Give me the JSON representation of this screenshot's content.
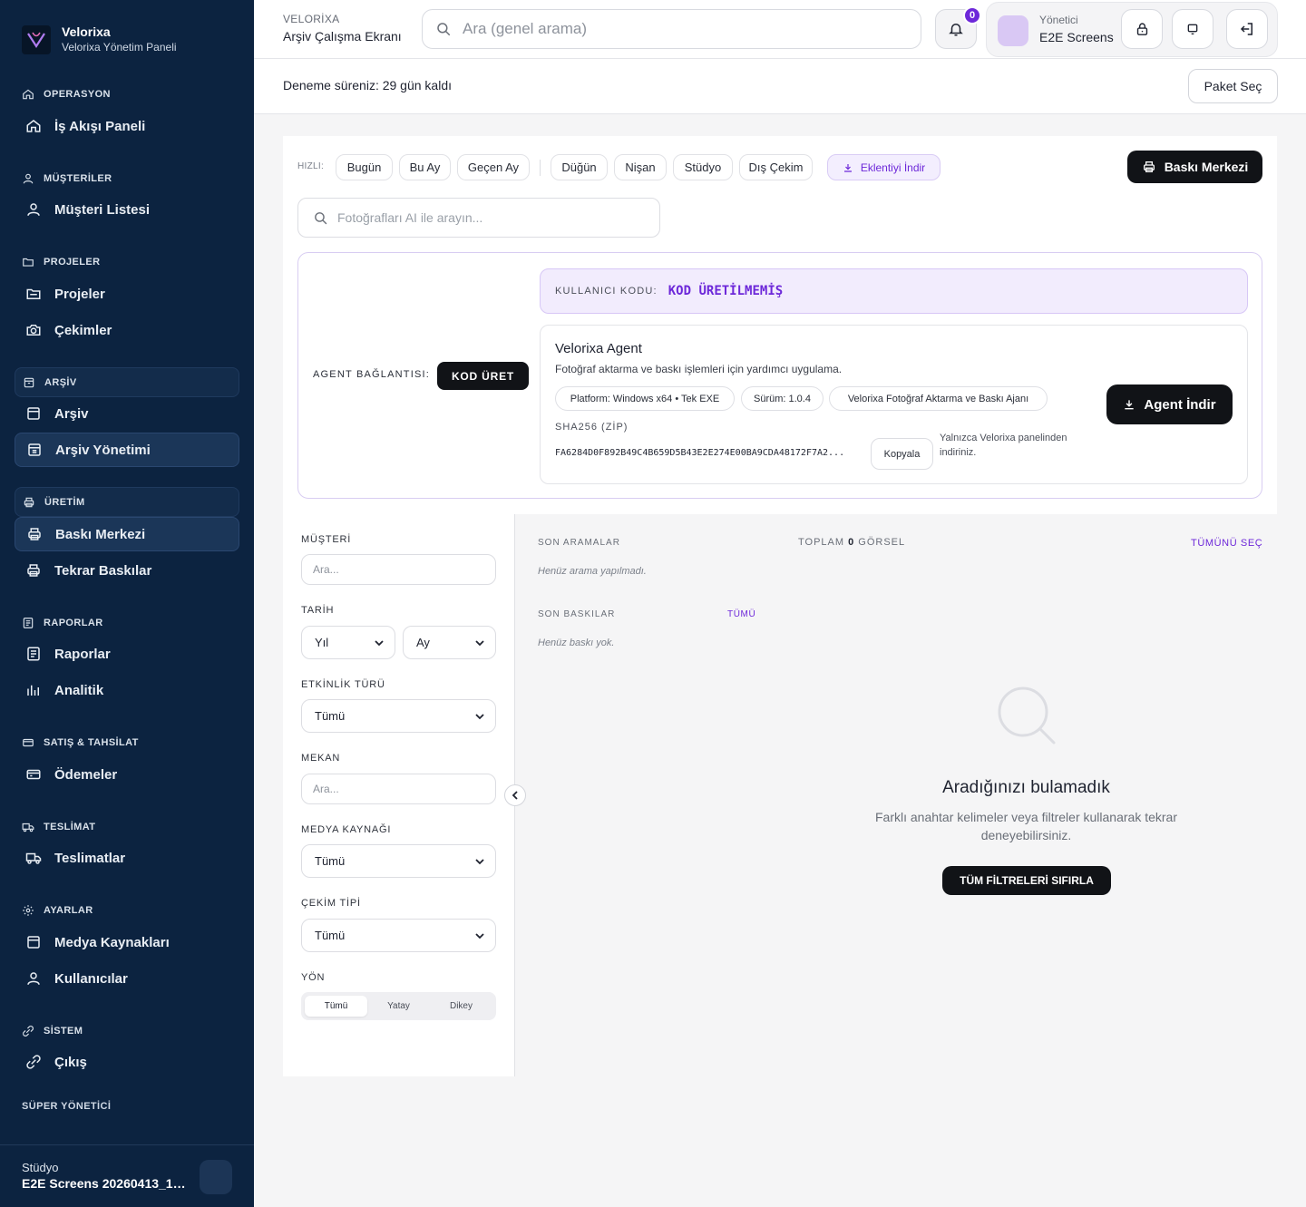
{
  "brand": {
    "name": "Velorixa",
    "subtitle": "Velorixa Yönetim Paneli"
  },
  "sidebar": {
    "sections": [
      {
        "title": "OPERASYON",
        "items": [
          {
            "label": "İş Akışı Paneli"
          }
        ]
      },
      {
        "title": "MÜŞTERİLER",
        "items": [
          {
            "label": "Müşteri Listesi"
          }
        ]
      },
      {
        "title": "PROJELER",
        "items": [
          {
            "label": "Projeler"
          },
          {
            "label": "Çekimler"
          }
        ]
      },
      {
        "title": "ARŞİV",
        "items": [
          {
            "label": "Arşiv"
          },
          {
            "label": "Arşiv Yönetimi",
            "active": true
          }
        ]
      },
      {
        "title": "ÜRETİM",
        "items": [
          {
            "label": "Baskı Merkezi",
            "active": true
          },
          {
            "label": "Tekrar Baskılar"
          }
        ]
      },
      {
        "title": "RAPORLAR",
        "items": [
          {
            "label": "Raporlar"
          },
          {
            "label": "Analitik"
          }
        ]
      },
      {
        "title": "SATIŞ & TAHSİLAT",
        "items": [
          {
            "label": "Ödemeler"
          }
        ]
      },
      {
        "title": "TESLİMAT",
        "items": [
          {
            "label": "Teslimatlar"
          }
        ]
      },
      {
        "title": "AYARLAR",
        "items": [
          {
            "label": "Medya Kaynakları"
          },
          {
            "label": "Kullanıcılar"
          }
        ]
      },
      {
        "title": "SİSTEM",
        "items": [
          {
            "label": "Çıkış"
          }
        ]
      }
    ],
    "super_admin": "SÜPER YÖNETİCİ",
    "footer": {
      "label": "Stüdyo",
      "studio_name": "E2E Screens 20260413_15..."
    }
  },
  "topbar": {
    "app_label": "VELORİXA",
    "screen_title": "Arşiv Çalışma Ekranı",
    "search_placeholder": "Ara (genel arama)",
    "notification_count": "0",
    "user": {
      "role": "Yönetici",
      "name": "E2E Screens"
    }
  },
  "trial": {
    "text": "Deneme süreniz: 29 gün kaldı",
    "button": "Paket Seç"
  },
  "quick": {
    "label": "HIZLI:",
    "chips": [
      "Bugün",
      "Bu Ay",
      "Geçen Ay",
      "Düğün",
      "Nişan",
      "Stüdyo",
      "Dış Çekim"
    ],
    "extension": "Eklentiyi İndir",
    "print_center": "Baskı Merkezi"
  },
  "ai_search": {
    "placeholder": "Fotoğrafları AI ile arayın..."
  },
  "agent": {
    "connection_label": "AGENT BAĞLANTISI:",
    "generate_button": "KOD ÜRET",
    "user_code_label": "KULLANICI KODU:",
    "user_code_value": "KOD ÜRETİLMEMİŞ",
    "title": "Velorixa Agent",
    "description": "Fotoğraf aktarma ve baskı işlemleri için yardımcı uygulama.",
    "pills": [
      "Platform: Windows x64 • Tek EXE",
      "Sürüm: 1.0.4",
      "Velorixa Fotoğraf Aktarma ve Baskı Ajanı"
    ],
    "sha_label": "SHA256 (ZİP)",
    "sha_value": "FA6284D0F892B49C4B659D5B43E2E274E00BA9CDA48172F7A2...",
    "copy_button": "Kopyala",
    "note": "Yalnızca Velorixa panelinden indiriniz.",
    "download_button": "Agent İndir"
  },
  "filters": {
    "customer": {
      "label": "MÜŞTERİ",
      "placeholder": "Ara..."
    },
    "date": {
      "label": "TARİH",
      "year": "Yıl",
      "month": "Ay"
    },
    "event_type": {
      "label": "ETKİNLİK TÜRÜ",
      "value": "Tümü"
    },
    "venue": {
      "label": "MEKAN",
      "placeholder": "Ara..."
    },
    "media_source": {
      "label": "MEDYA KAYNAĞI",
      "value": "Tümü"
    },
    "shoot_type": {
      "label": "ÇEKİM TİPİ",
      "value": "Tümü"
    },
    "orientation": {
      "label": "YÖN",
      "options": [
        "Tümü",
        "Yatay",
        "Dikey"
      ],
      "selected": "Tümü"
    }
  },
  "results": {
    "recent_searches": {
      "title": "SON ARAMALAR",
      "empty": "Henüz arama yapılmadı."
    },
    "total": {
      "prefix": "TOPLAM",
      "count": "0",
      "suffix": "GÖRSEL"
    },
    "select_all": "TÜMÜNÜ SEÇ",
    "recent_prints": {
      "title": "SON BASKILAR",
      "all_link": "TÜMÜ",
      "empty": "Henüz baskı yok."
    },
    "empty_state": {
      "title": "Aradığınızı bulamadık",
      "description": "Farklı anahtar kelimeler veya filtreler kullanarak tekrar deneyebilirsiniz.",
      "reset_button": "TÜM FİLTRELERİ SIFIRLA"
    }
  },
  "colors": {
    "sidebar_bg": "#0c2340",
    "accent": "#6d28d9",
    "primary_button": "#111317"
  }
}
